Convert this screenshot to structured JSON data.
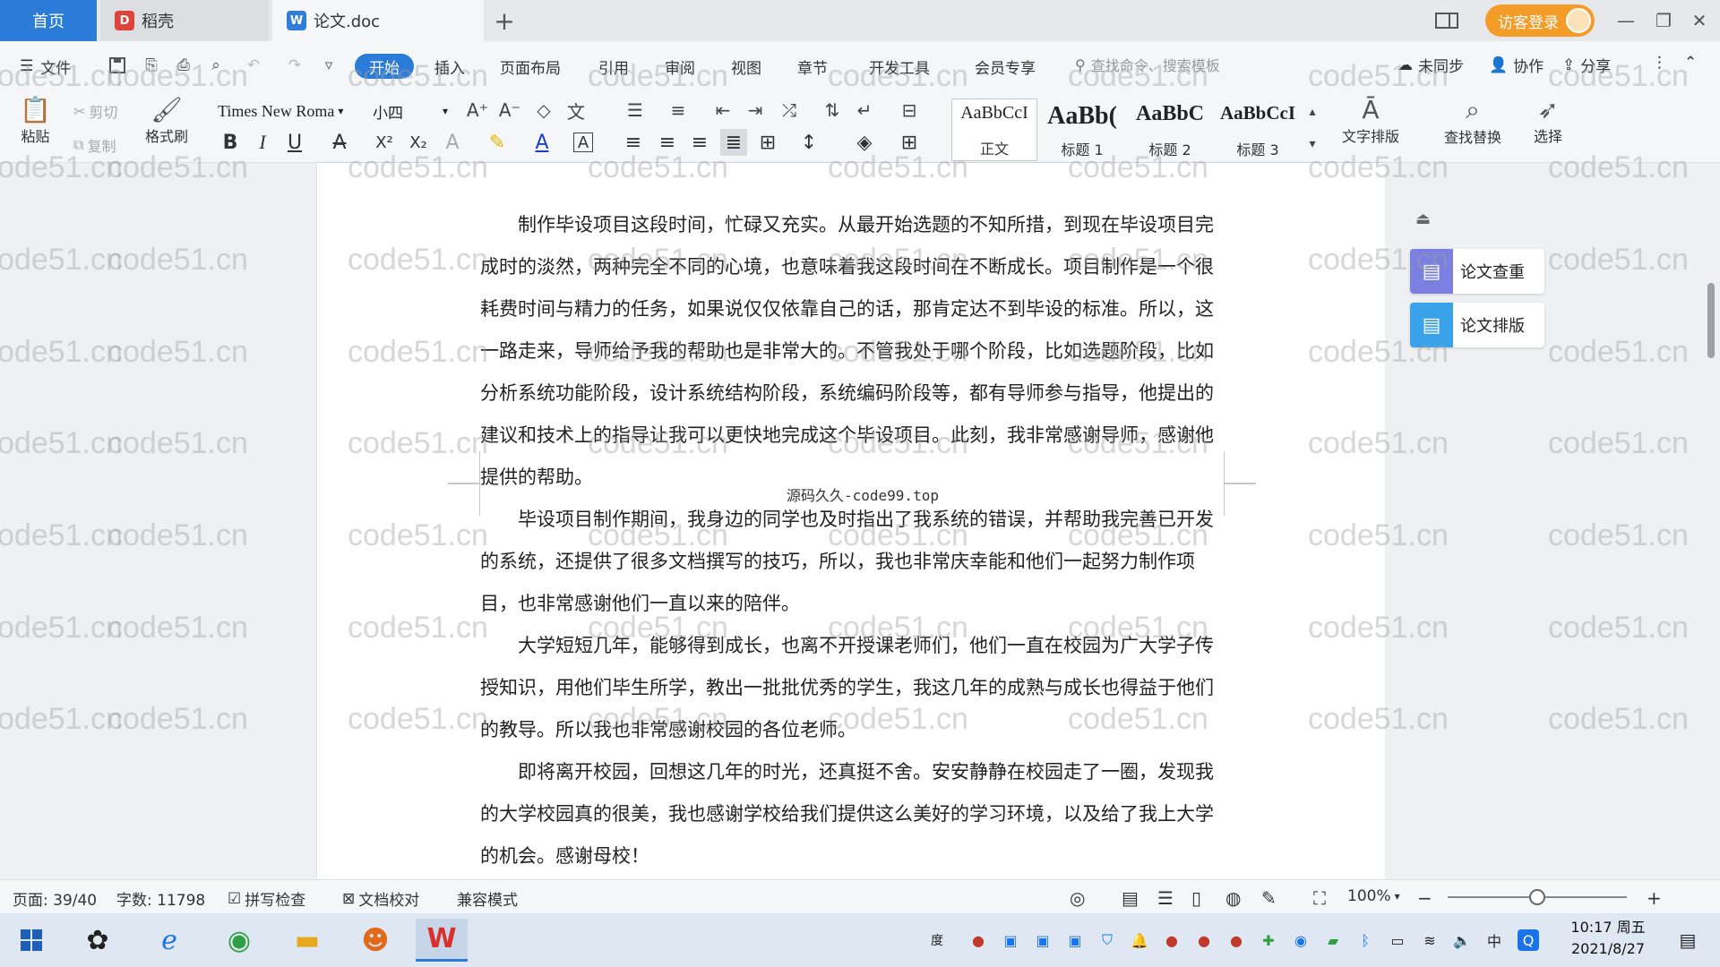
{
  "tabs": {
    "home": "首页",
    "daoke": "稻壳",
    "doc": "论文.doc",
    "add": "+"
  },
  "header_right": {
    "visitor_login": "访客登录"
  },
  "menubar": {
    "file": "文件",
    "items": [
      "开始",
      "插入",
      "页面布局",
      "引用",
      "审阅",
      "视图",
      "章节",
      "开发工具",
      "会员专享"
    ],
    "search_placeholder": "查找命令、搜索模板",
    "unsynced": "未同步",
    "collab": "协作",
    "share": "分享"
  },
  "ribbon": {
    "paste": "粘贴",
    "cut": "剪切",
    "copy": "复制",
    "format_painter": "格式刷",
    "font_name": "Times New Roma",
    "font_size": "小四",
    "styles": [
      {
        "preview": "AaBbCcI",
        "name": "正文"
      },
      {
        "preview": "AaBb(",
        "name": "标题 1"
      },
      {
        "preview": "AaBbC",
        "name": "标题 2"
      },
      {
        "preview": "AaBbCcI",
        "name": "标题 3"
      }
    ],
    "text_layout": "文字排版",
    "find_replace": "查找替换",
    "select": "选择"
  },
  "document": {
    "paragraphs": [
      "制作毕设项目这段时间，忙碌又充实。从最开始选题的不知所措，到现在毕设项目完成时的淡然，两种完全不同的心境，也意味着我这段时间在不断成长。项目制作是一个很耗费时间与精力的任务，如果说仅仅依靠自己的话，那肯定达不到毕设的标准。所以，这一路走来，导师给予我的帮助也是非常大的。不管我处于哪个阶段，比如选题阶段，比如分析系统功能阶段，设计系统结构阶段，系统编码阶段等，都有导师参与指导，他提出的建议和技术上的指导让我可以更快地完成这个毕设项目。此刻，我非常感谢导师，感谢他提供的帮助。",
      "毕设项目制作期间，我身边的同学也及时指出了我系统的错误，并帮助我完善已开发的系统，还提供了很多文档撰写的技巧，所以，我也非常庆幸能和他们一起努力制作项目，也非常感谢他们一直以来的陪伴。",
      "大学短短几年，能够得到成长，也离不开授课老师们，他们一直在校园为广大学子传授知识，用他们毕生所学，教出一批批优秀的学生，我这几年的成熟与成长也得益于他们的教导。所以我也非常感谢校园的各位老师。",
      "即将离开校园，回想这几年的时光，还真挺不舍。安安静静在校园走了一圈，发现我的大学校园真的很美，我也感谢学校给我们提供这么美好的学习环境，以及给了我上大学的机会。感谢母校！"
    ],
    "overlay_caption": "源码久久-code99.top",
    "watermark": "code51.cn"
  },
  "right_panel": {
    "check": "论文查重",
    "layout": "论文排版"
  },
  "statusbar": {
    "page": "页面: 39/40",
    "words": "字数: 11798",
    "spellcheck": "拼写检查",
    "proof": "文档校对",
    "compat": "兼容模式",
    "zoom": "100%",
    "zoom_level": 0.5
  },
  "taskbar": {
    "time": "10:17 周五",
    "date": "2021/8/27",
    "ime": "中",
    "baidu": "度"
  },
  "colors": {
    "accent": "#2b7bd9",
    "visitor": "#f39c28"
  }
}
